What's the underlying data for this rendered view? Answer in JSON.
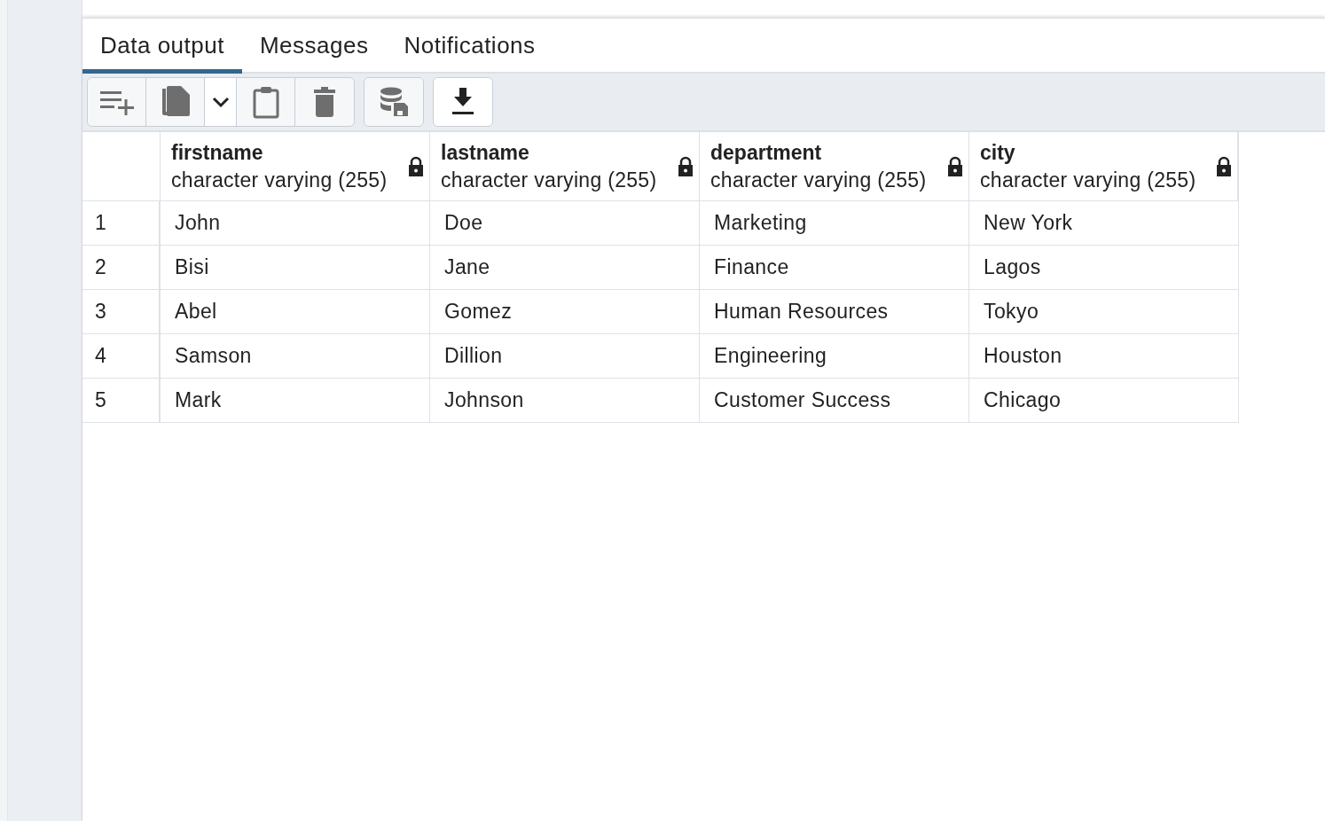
{
  "tabs": [
    {
      "label": "Data output",
      "selected": true
    },
    {
      "label": "Messages",
      "selected": false
    },
    {
      "label": "Notifications",
      "selected": false
    }
  ],
  "toolbar": {
    "groups": [
      [
        {
          "kind": "add-row",
          "disabled": true
        },
        {
          "kind": "copy",
          "disabled": true
        },
        {
          "kind": "dropdown",
          "disabled": false
        },
        {
          "kind": "paste",
          "disabled": true
        },
        {
          "kind": "delete",
          "disabled": true
        }
      ],
      [
        {
          "kind": "save-data",
          "disabled": true
        }
      ],
      [
        {
          "kind": "download",
          "disabled": false
        }
      ]
    ]
  },
  "table": {
    "columns": [
      {
        "name": "firstname",
        "type": "character varying (255)",
        "locked": true
      },
      {
        "name": "lastname",
        "type": "character varying (255)",
        "locked": true
      },
      {
        "name": "department",
        "type": "character varying (255)",
        "locked": true
      },
      {
        "name": "city",
        "type": "character varying (255)",
        "locked": true
      }
    ],
    "rows": [
      {
        "number": "1",
        "cells": [
          "John",
          "Doe",
          "Marketing",
          "New York"
        ]
      },
      {
        "number": "2",
        "cells": [
          "Bisi",
          "Jane",
          "Finance",
          "Lagos"
        ]
      },
      {
        "number": "3",
        "cells": [
          "Abel",
          "Gomez",
          "Human Resources",
          "Tokyo"
        ]
      },
      {
        "number": "4",
        "cells": [
          "Samson",
          "Dillion",
          "Engineering",
          "Houston"
        ]
      },
      {
        "number": "5",
        "cells": [
          "Mark",
          "Johnson",
          "Customer Success",
          "Chicago"
        ]
      }
    ]
  }
}
